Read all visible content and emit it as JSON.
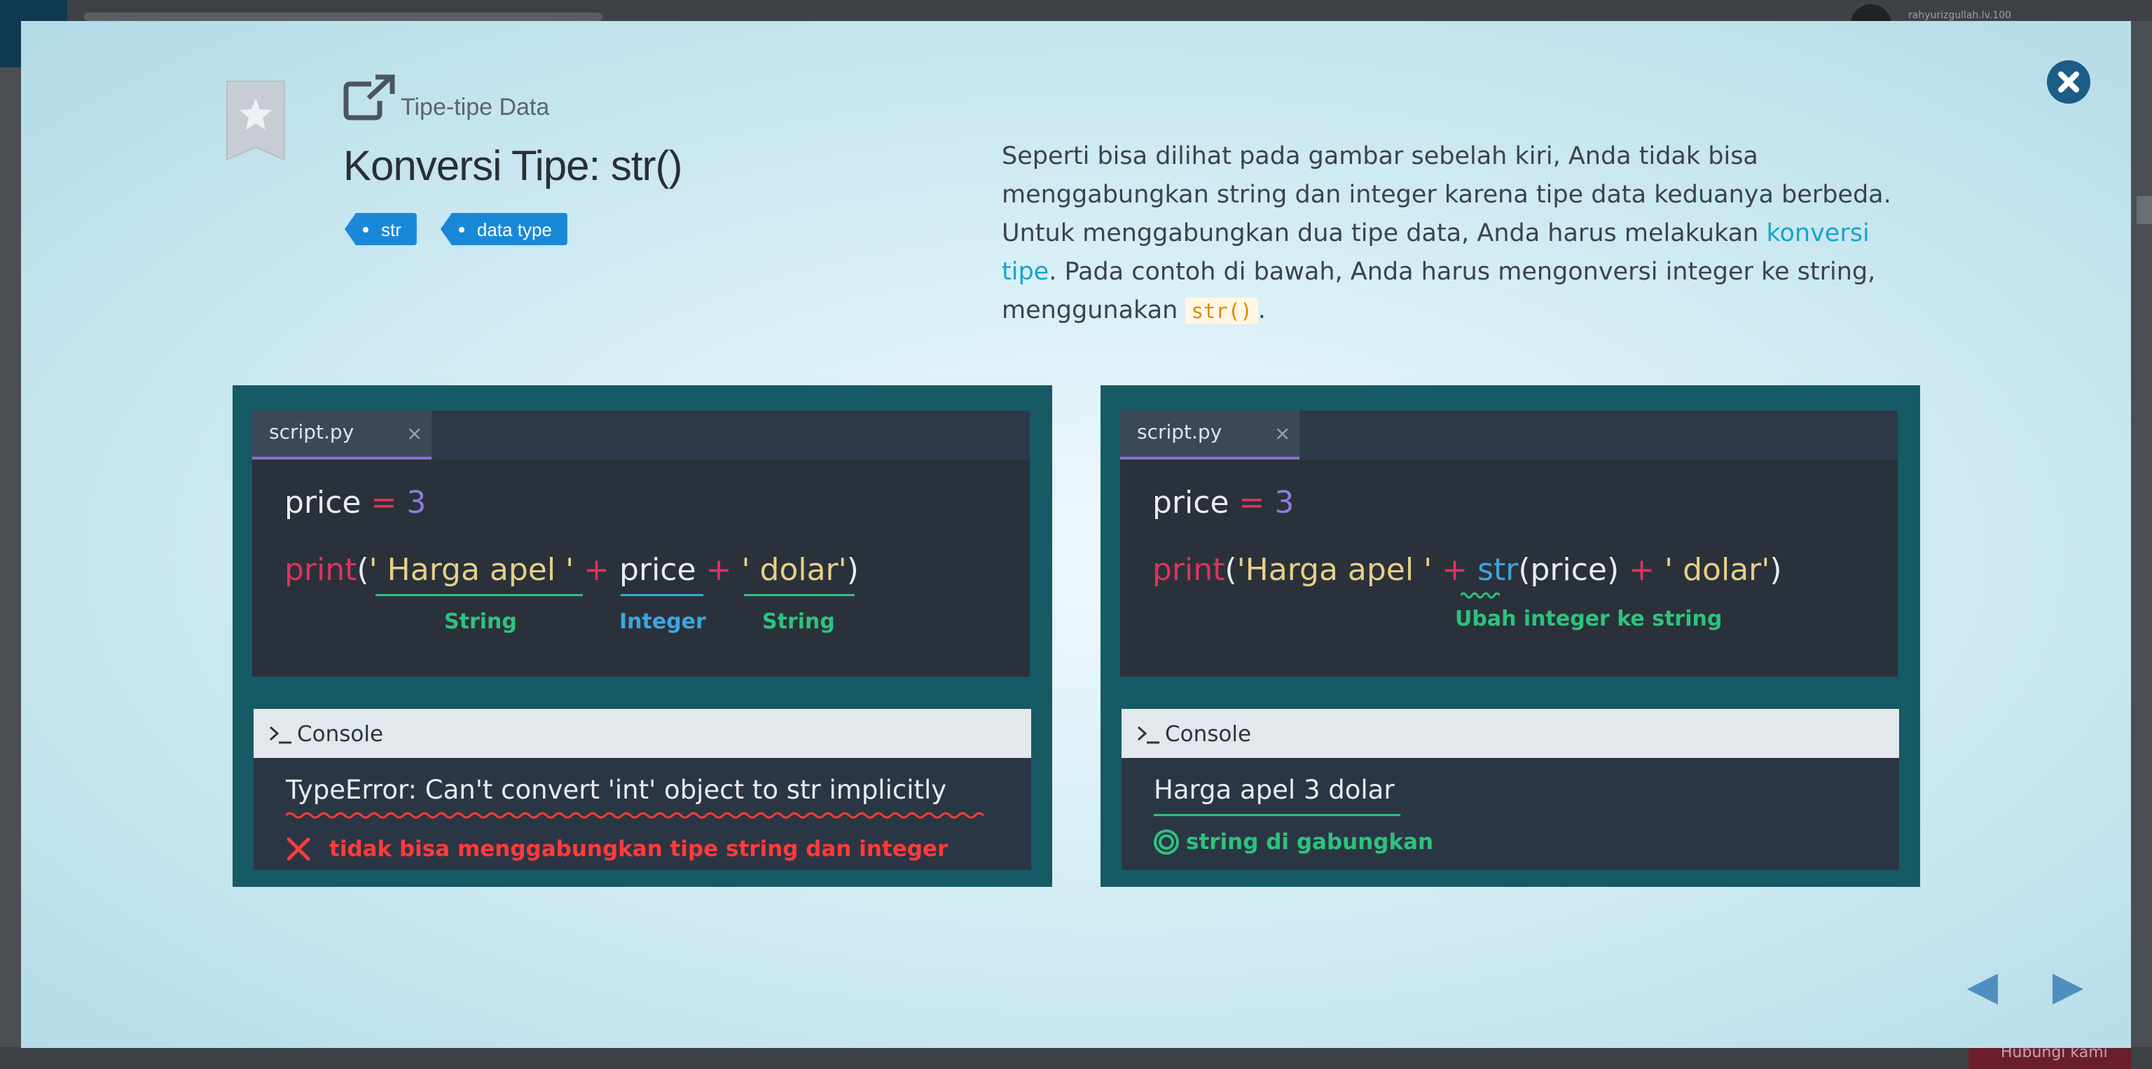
{
  "background": {
    "user_name": "rahyurizgullah.lv.100",
    "bottom_button": "Hubungi kami"
  },
  "lesson": {
    "category": "Tipe-tipe Data",
    "title": "Konversi Tipe: str()",
    "tags": [
      "str",
      "data type"
    ],
    "description": {
      "part1": "Seperti bisa dilihat pada gambar sebelah kiri, Anda tidak bisa menggabungkan string dan integer karena tipe data keduanya berbeda. Untuk menggabungkan dua tipe data, Anda harus melakukan ",
      "link": "konversi tipe",
      "part2": ". Pada contoh di bawah, Anda harus mengonversi integer ke string, menggunakan ",
      "code": "str()",
      "part3": "."
    }
  },
  "left_panel": {
    "tab_label": "script.py",
    "tab_close": "×",
    "line1": {
      "var": "price",
      "op": "=",
      "num": "3"
    },
    "line2": {
      "func": "print",
      "open": "(",
      "str1": "' Harga apel '",
      "plus1": "+",
      "var": "price",
      "plus2": "+",
      "str2": "' dolar'",
      "close": ")"
    },
    "labels": {
      "string1": "String",
      "integer": "Integer",
      "string2": "String"
    },
    "console_title": "Console",
    "console_output": "TypeError: Can't convert 'int' object to str implicitly",
    "console_note": "tidak bisa menggabungkan tipe string dan integer"
  },
  "right_panel": {
    "tab_label": "script.py",
    "tab_close": "×",
    "line1": {
      "var": "price",
      "op": "=",
      "num": "3"
    },
    "line2": {
      "func": "print",
      "open": "(",
      "str1": "'Harga apel '",
      "plus1": "+",
      "fn": "str",
      "arg": "(price)",
      "plus2": "+",
      "str2": "' dolar'",
      "close": ")"
    },
    "label": "Ubah integer ke string",
    "console_title": "Console",
    "console_output": "Harga apel 3 dolar",
    "console_note": "string di gabungkan"
  },
  "colors": {
    "accent": "#1a88d8",
    "error": "#ff3b3b",
    "success": "#2ec27e",
    "panel": "#165a66"
  },
  "icons": [
    "bookmark-icon",
    "external-link-icon",
    "close-icon",
    "console-prompt-icon",
    "cross-icon",
    "success-circle-icon",
    "prev-arrow-icon",
    "next-arrow-icon"
  ]
}
